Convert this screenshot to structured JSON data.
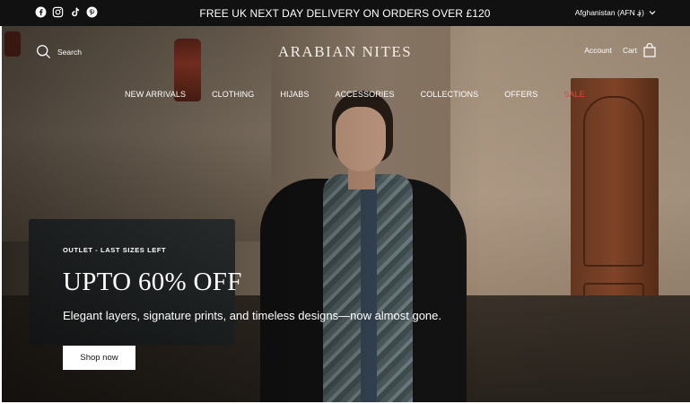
{
  "announcement": {
    "text": "FREE UK NEXT DAY DELIVERY ON ORDERS OVER £120",
    "social_icons": [
      "facebook-icon",
      "instagram-icon",
      "tiktok-icon",
      "pinterest-icon"
    ],
    "country_selector": "Afghanistan (AFN ؋)"
  },
  "header": {
    "logo": "ARABIAN NITES",
    "search_label": "Search",
    "account_label": "Account",
    "cart_label": "Cart"
  },
  "nav": {
    "items": [
      "NEW ARRIVALS",
      "CLOTHING",
      "HIJABS",
      "ACCESSORIES",
      "COLLECTIONS",
      "OFFERS",
      "SALE"
    ]
  },
  "hero": {
    "eyebrow": "OUTLET - LAST SIZES LEFT",
    "headline": "UPTO 60% OFF",
    "subtext": "Elegant layers, signature prints, and timeless designs—now almost gone.",
    "cta_label": "Shop now"
  },
  "colors": {
    "announcement_bg": "#111111",
    "sale_accent": "#e0483a",
    "cta_bg": "#ffffff"
  }
}
